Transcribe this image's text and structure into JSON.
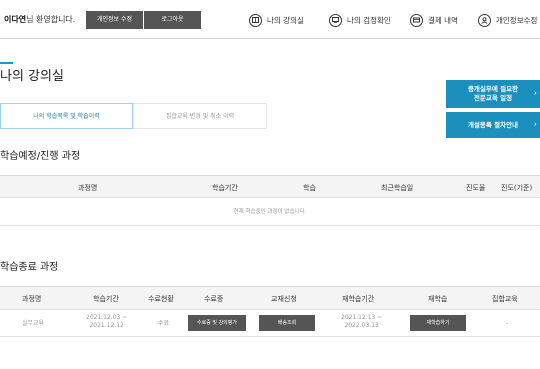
{
  "header": {
    "user_name": "이다연",
    "welcome_suffix": "님 환영합니다.",
    "edit_profile_label": "개인정보 수정",
    "logout_label": "로그아웃",
    "nav": [
      {
        "label": "나의 강의실",
        "icon": "book-icon"
      },
      {
        "label": "나의 검정확인",
        "icon": "certificate-icon"
      },
      {
        "label": "결제 내역",
        "icon": "payment-icon"
      },
      {
        "label": "개인정보수정",
        "icon": "person-icon"
      }
    ]
  },
  "page": {
    "title": "나의 강의실"
  },
  "tabs": [
    {
      "label": "나의 학습목록 및 학습이력",
      "active": true
    },
    {
      "label": "집합교육 변경 및 취소 이력",
      "active": false
    }
  ],
  "side_buttons": [
    {
      "line1": "중개실무에 필요한",
      "line2": "전문교육 일정"
    },
    {
      "line1": "개설등록 절차안내",
      "line2": ""
    }
  ],
  "ongoing": {
    "title": "학습예정/진행 과정",
    "columns": [
      "과정명",
      "학습기간",
      "학습",
      "최근학습일",
      "진도율",
      "진도(기준)"
    ],
    "empty_message": "현재 학습중인 과정이 없습니다."
  },
  "completed": {
    "title": "학습종료 과정",
    "columns": [
      "과정명",
      "학습기간",
      "수료현황",
      "수료증",
      "교재신청",
      "재학습기간",
      "재학습",
      "집합교육"
    ],
    "rows": [
      {
        "course": "실무교육",
        "period_start": "2021.12.03 ~",
        "period_end": "2021.12.12",
        "status": "수료",
        "certificate_button": "수료증 및 강의평가",
        "textbook_button": "배송조회",
        "relearn_start": "2021.12.13 ~",
        "relearn_end": "2022.03.13",
        "relearn_button": "재학습하기",
        "group_education": "-"
      }
    ]
  }
}
